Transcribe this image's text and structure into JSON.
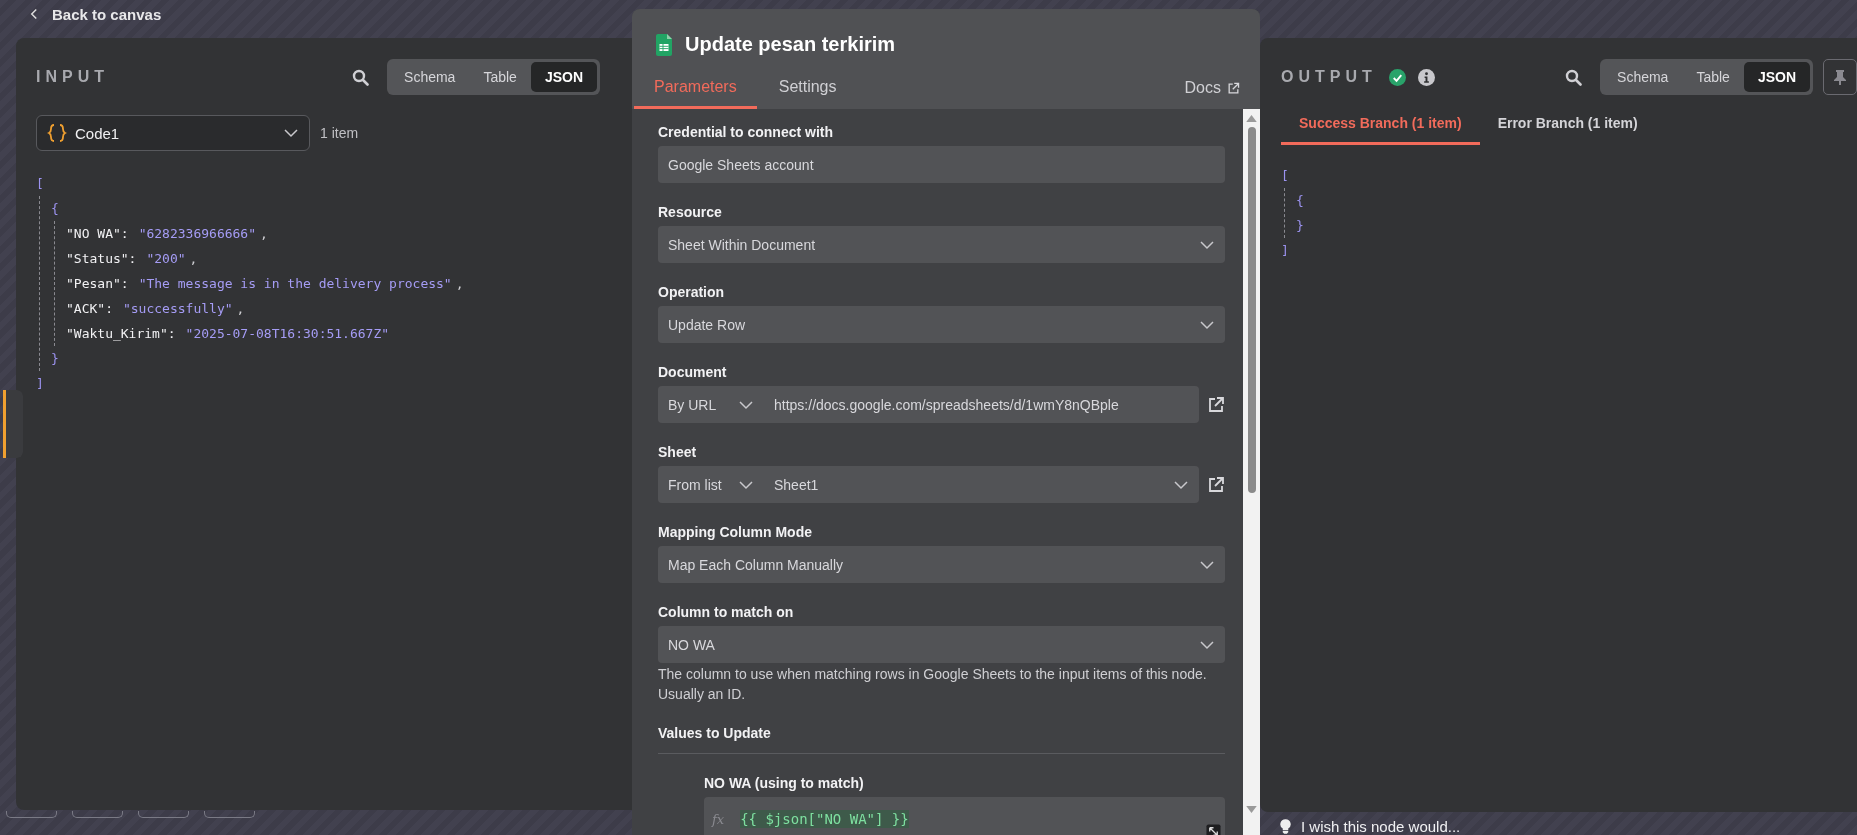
{
  "top_bar": {
    "back_link": "Back to canvas"
  },
  "input_panel": {
    "title": "INPUT",
    "view_tabs": [
      {
        "label": "Schema",
        "selected": false
      },
      {
        "label": "Table",
        "selected": false
      },
      {
        "label": "JSON",
        "selected": true
      }
    ],
    "source": {
      "node": "Code1",
      "count": "1 item"
    },
    "json": {
      "open": "[",
      "close": "]",
      "children": [
        {
          "open": "{",
          "close": "}",
          "entries": [
            {
              "key": "\"NO WA\":",
              "value": "\"6282336966666\"",
              "comma": ","
            },
            {
              "key": "\"Status\":",
              "value": "\"200\"",
              "comma": ","
            },
            {
              "key": "\"Pesan\":",
              "value": "\"The message is in the delivery process\"",
              "comma": ","
            },
            {
              "key": "\"ACK\":",
              "value": "\"successfully\"",
              "comma": ","
            },
            {
              "key": "\"Waktu_Kirim\":",
              "value": "\"2025-07-08T16:30:51.667Z\""
            }
          ]
        }
      ]
    }
  },
  "node_panel": {
    "title": "Update pesan terkirim",
    "tabs": [
      {
        "label": "Parameters",
        "selected": true
      },
      {
        "label": "Settings",
        "selected": false
      }
    ],
    "docs_link": "Docs",
    "parameters": [
      {
        "kind": "input",
        "label": "Credential to connect with",
        "value": "Google Sheets account"
      },
      {
        "kind": "select",
        "label": "Resource",
        "value": "Sheet Within Document"
      },
      {
        "kind": "select",
        "label": "Operation",
        "value": "Update Row"
      },
      {
        "kind": "locator",
        "label": "Document",
        "mode": "By URL",
        "value": "https://docs.google.com/spreadsheets/d/1wmY8nQBple",
        "value_dropdown": false
      },
      {
        "kind": "locator",
        "label": "Sheet",
        "mode": "From list",
        "value": "Sheet1",
        "value_dropdown": true
      },
      {
        "kind": "select",
        "label": "Mapping Column Mode",
        "value": "Map Each Column Manually"
      },
      {
        "kind": "select",
        "label": "Column to match on",
        "value": "NO WA",
        "hint": "The column to use when matching rows in Google Sheets to the input items of this node. Usually an ID."
      },
      {
        "kind": "section",
        "label": "Values to Update"
      },
      {
        "kind": "expression",
        "label": "NO WA (using to match)",
        "prefix": "fx",
        "value": "{{ $json[\"NO WA\"] }}"
      }
    ]
  },
  "output_panel": {
    "title": "OUTPUT",
    "view_tabs": [
      {
        "label": "Schema",
        "selected": false
      },
      {
        "label": "Table",
        "selected": false
      },
      {
        "label": "JSON",
        "selected": true
      }
    ],
    "branches": [
      {
        "label": "Success Branch (1 item)",
        "selected": true
      },
      {
        "label": "Error Branch (1 item)",
        "selected": false
      }
    ],
    "json": {
      "open": "[",
      "close": "]",
      "children": [
        {
          "open": "{",
          "close": "}"
        }
      ]
    }
  },
  "feedback": {
    "text": "I wish this node would..."
  }
}
